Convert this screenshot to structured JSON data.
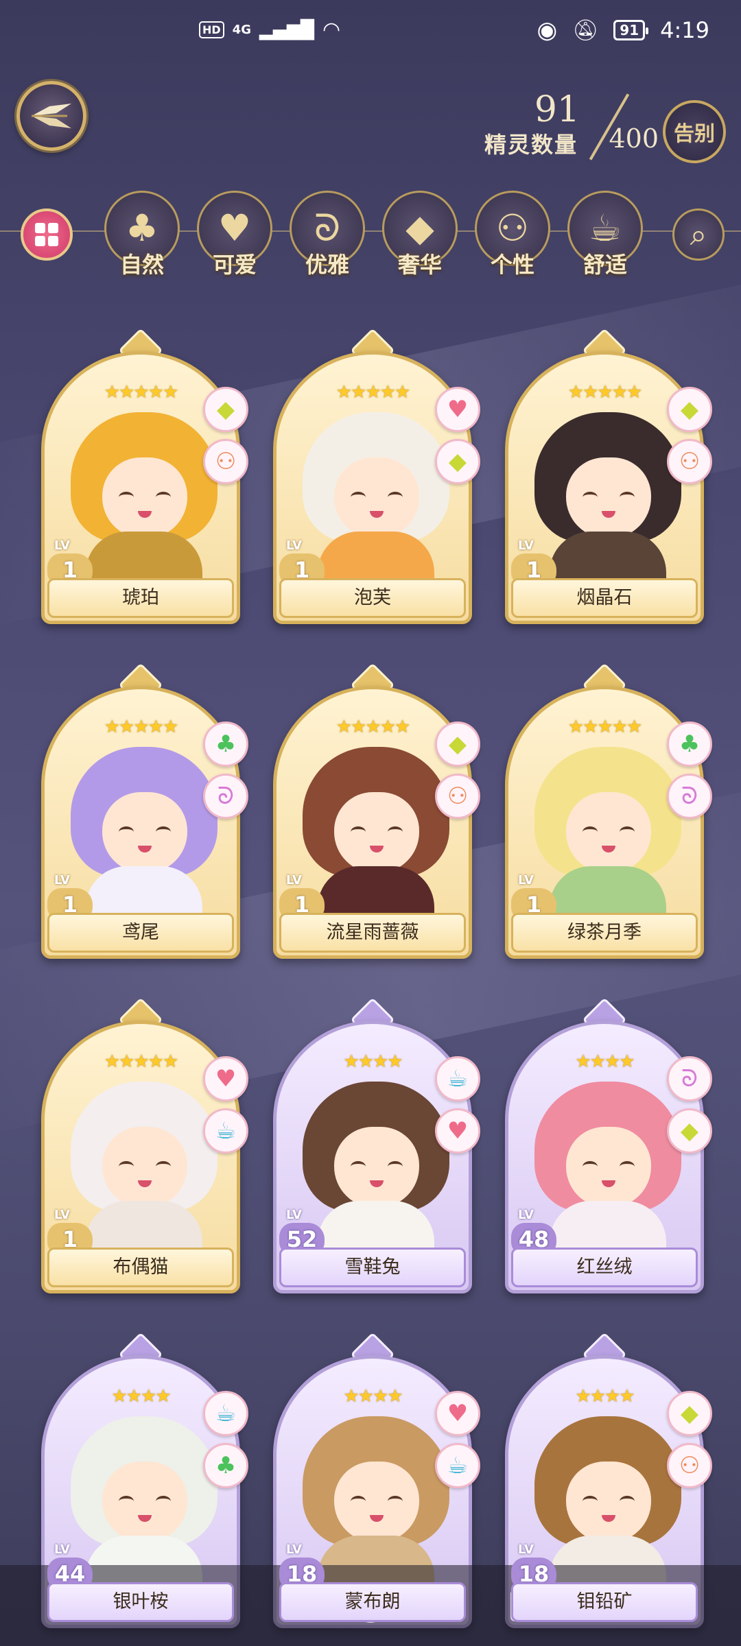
{
  "status_bar": {
    "hd": "HD",
    "network": "4G",
    "battery": "91",
    "time": "4:19"
  },
  "header": {
    "spirit_count_current": "91",
    "spirit_count_label": "精灵数量",
    "spirit_count_max": "400",
    "farewell_label": "告别"
  },
  "filters": [
    {
      "label": "自然",
      "icon": "clover-icon",
      "glyph": "♣"
    },
    {
      "label": "可爱",
      "icon": "heart-icon",
      "glyph": "♥"
    },
    {
      "label": "优雅",
      "icon": "swan-icon",
      "glyph": "ᘐ"
    },
    {
      "label": "奢华",
      "icon": "diamond-icon",
      "glyph": "◆"
    },
    {
      "label": "个性",
      "icon": "glasses-icon",
      "glyph": "⚇"
    },
    {
      "label": "舒适",
      "icon": "teacup-icon",
      "glyph": "☕"
    }
  ],
  "cards": [
    {
      "name": "琥珀",
      "lv_tag": "LV",
      "level": "1",
      "stars": "★★★★★",
      "theme": "gold",
      "hair": "#f2b233",
      "body": "#c99a3a",
      "badges": [
        {
          "icon": "diamond-icon",
          "glyph": "◆",
          "color": "#c8d836"
        },
        {
          "icon": "glasses-icon",
          "glyph": "⚇",
          "color": "#ef8a5a"
        }
      ]
    },
    {
      "name": "泡芙",
      "lv_tag": "LV",
      "level": "1",
      "stars": "★★★★★",
      "theme": "gold",
      "hair": "#f4efe6",
      "body": "#f5a84a",
      "badges": [
        {
          "icon": "heart-icon",
          "glyph": "♥",
          "color": "#ef6b8a"
        },
        {
          "icon": "diamond-icon",
          "glyph": "◆",
          "color": "#c8d836"
        }
      ]
    },
    {
      "name": "烟晶石",
      "lv_tag": "LV",
      "level": "1",
      "stars": "★★★★★",
      "theme": "gold",
      "hair": "#3a2c2c",
      "body": "#5a4438",
      "badges": [
        {
          "icon": "diamond-icon",
          "glyph": "◆",
          "color": "#c8d836"
        },
        {
          "icon": "glasses-icon",
          "glyph": "⚇",
          "color": "#ef8a5a"
        }
      ]
    },
    {
      "name": "鸢尾",
      "lv_tag": "LV",
      "level": "1",
      "stars": "★★★★★",
      "theme": "gold",
      "hair": "#b39ae8",
      "body": "#f3f0fb",
      "badges": [
        {
          "icon": "clover-icon",
          "glyph": "♣",
          "color": "#4cc25c"
        },
        {
          "icon": "swan-icon",
          "glyph": "ᘐ",
          "color": "#d77ad8"
        }
      ]
    },
    {
      "name": "流星雨蔷薇",
      "lv_tag": "LV",
      "level": "1",
      "stars": "★★★★★",
      "theme": "gold",
      "hair": "#8a4a34",
      "body": "#5a2a2a",
      "badges": [
        {
          "icon": "diamond-icon",
          "glyph": "◆",
          "color": "#c8d836"
        },
        {
          "icon": "glasses-icon",
          "glyph": "⚇",
          "color": "#ef8a5a"
        }
      ]
    },
    {
      "name": "绿茶月季",
      "lv_tag": "LV",
      "level": "1",
      "stars": "★★★★★",
      "theme": "gold",
      "hair": "#f4e38c",
      "body": "#a8d08a",
      "badges": [
        {
          "icon": "clover-icon",
          "glyph": "♣",
          "color": "#4cc25c"
        },
        {
          "icon": "swan-icon",
          "glyph": "ᘐ",
          "color": "#d77ad8"
        }
      ]
    },
    {
      "name": "布偶猫",
      "lv_tag": "LV",
      "level": "1",
      "stars": "★★★★★",
      "theme": "gold",
      "hair": "#f4eeee",
      "body": "#efe6e0",
      "badges": [
        {
          "icon": "heart-icon",
          "glyph": "♥",
          "color": "#ef6b8a"
        },
        {
          "icon": "teacup-icon",
          "glyph": "☕",
          "color": "#48b8d8"
        }
      ]
    },
    {
      "name": "雪鞋兔",
      "lv_tag": "LV",
      "level": "52",
      "stars": "★★★★",
      "theme": "purple",
      "hair": "#6a4634",
      "body": "#f7f4f0",
      "badges": [
        {
          "icon": "teacup-icon",
          "glyph": "☕",
          "color": "#48b8d8"
        },
        {
          "icon": "heart-icon",
          "glyph": "♥",
          "color": "#ef6b8a"
        }
      ]
    },
    {
      "name": "红丝绒",
      "lv_tag": "LV",
      "level": "48",
      "stars": "★★★★",
      "theme": "purple",
      "hair": "#f08ca0",
      "body": "#f6eef2",
      "badges": [
        {
          "icon": "swan-icon",
          "glyph": "ᘐ",
          "color": "#d77ad8"
        },
        {
          "icon": "diamond-icon",
          "glyph": "◆",
          "color": "#c8d836"
        }
      ]
    },
    {
      "name": "银叶桉",
      "lv_tag": "LV",
      "level": "44",
      "stars": "★★★★",
      "theme": "purple",
      "hair": "#eef0ea",
      "body": "#f4f6f2",
      "badges": [
        {
          "icon": "teacup-icon",
          "glyph": "☕",
          "color": "#48b8d8"
        },
        {
          "icon": "clover-icon",
          "glyph": "♣",
          "color": "#4cc25c"
        }
      ]
    },
    {
      "name": "蒙布朗",
      "lv_tag": "LV",
      "level": "18",
      "stars": "★★★★",
      "theme": "purple",
      "hair": "#c99a62",
      "body": "#d8b88a",
      "badges": [
        {
          "icon": "heart-icon",
          "glyph": "♥",
          "color": "#ef6b8a"
        },
        {
          "icon": "teacup-icon",
          "glyph": "☕",
          "color": "#48b8d8"
        }
      ]
    },
    {
      "name": "钼铅矿",
      "lv_tag": "LV",
      "level": "18",
      "stars": "★★★★",
      "theme": "purple",
      "hair": "#a8743e",
      "body": "#f2ece4",
      "badges": [
        {
          "icon": "diamond-icon",
          "glyph": "◆",
          "color": "#c8d836"
        },
        {
          "icon": "glasses-icon",
          "glyph": "⚇",
          "color": "#ef8a5a"
        }
      ]
    }
  ]
}
